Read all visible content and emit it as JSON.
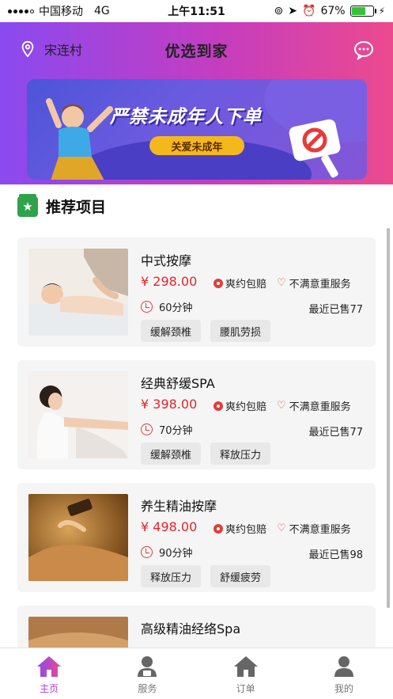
{
  "status_bar": {
    "carrier": "中国移动",
    "network": "4G",
    "time": "上午11:51",
    "battery_percent": "67%",
    "battery_level": 0.67
  },
  "header": {
    "location": "宋连村",
    "title": "优选到家",
    "gradient_colors": [
      "#8a4af0",
      "#c43dc0",
      "#ec4a8e"
    ]
  },
  "banner": {
    "headline": "严禁未成年人下单",
    "tag": "关爱未成年"
  },
  "section": {
    "title": "推荐项目"
  },
  "items": [
    {
      "name": "中式按摩",
      "price": "¥ 298.00",
      "guarantee": "爽约包赔",
      "refund": "不满意重服务",
      "duration": "60分钟",
      "sold": "最近已售77",
      "tags": [
        "缓解颈椎",
        "腰肌劳损"
      ]
    },
    {
      "name": "经典舒缓SPA",
      "price": "¥ 398.00",
      "guarantee": "爽约包赔",
      "refund": "不满意重服务",
      "duration": "70分钟",
      "sold": "最近已售77",
      "tags": [
        "缓解颈椎",
        "释放压力"
      ]
    },
    {
      "name": "养生精油按摩",
      "price": "¥ 498.00",
      "guarantee": "爽约包赔",
      "refund": "不满意重服务",
      "duration": "90分钟",
      "sold": "最近已售98",
      "tags": [
        "释放压力",
        "舒缓疲劳"
      ]
    },
    {
      "name": "高级精油经络Spa",
      "price": "",
      "guarantee": "",
      "refund": "",
      "duration": "",
      "sold": "",
      "tags": []
    }
  ],
  "tabbar": {
    "tabs": [
      {
        "label": "主页",
        "icon": "home-icon",
        "active": true
      },
      {
        "label": "服务",
        "icon": "service-icon",
        "active": false
      },
      {
        "label": "订单",
        "icon": "order-icon",
        "active": false
      },
      {
        "label": "我的",
        "icon": "profile-icon",
        "active": false
      }
    ]
  },
  "colors": {
    "accent": "#b53ad8",
    "price": "#e4252d",
    "section_icon": "#2fa34a"
  }
}
